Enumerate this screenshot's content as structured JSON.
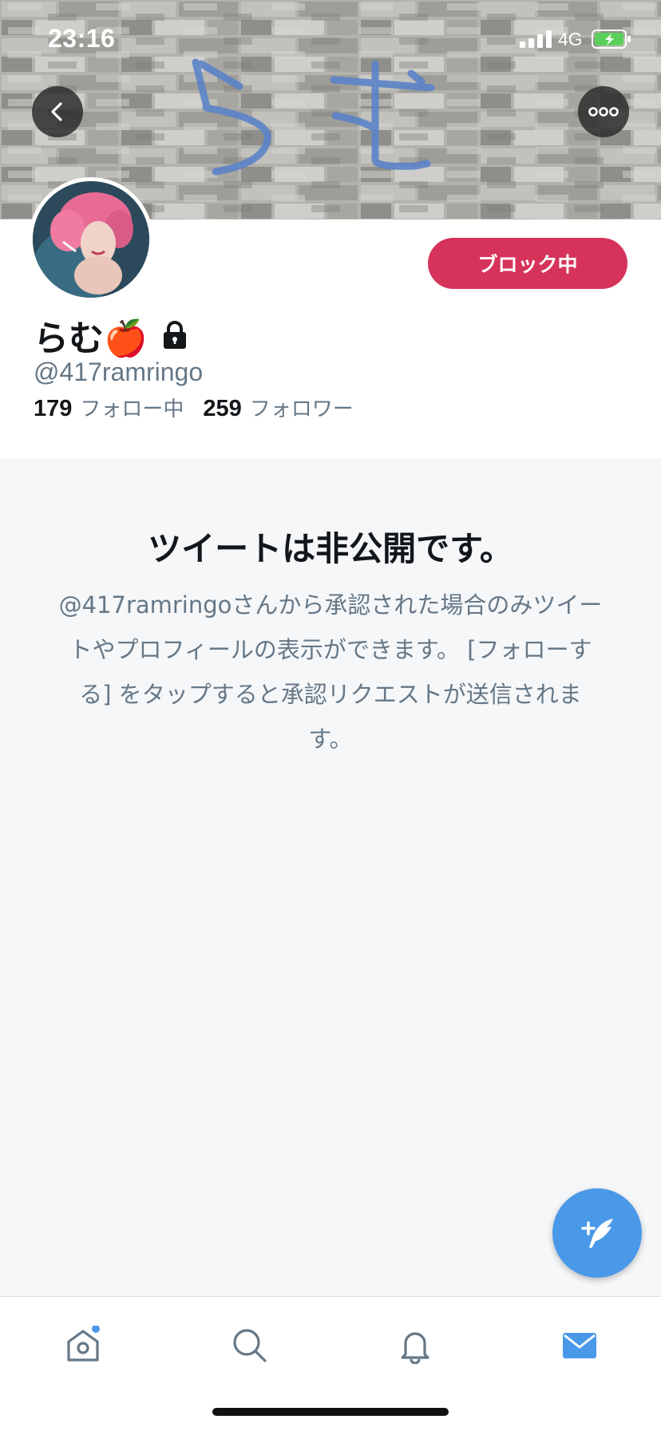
{
  "status_bar": {
    "time": "23:16",
    "network": "4G"
  },
  "banner": {
    "handwriting": "らむ"
  },
  "icons": {
    "back": "chevron-left-icon",
    "more": "more-dots-icon",
    "lock": "lock-icon",
    "compose": "compose-tweet-icon",
    "home": "home-icon",
    "search": "search-icon",
    "notifications": "bell-icon",
    "messages": "envelope-icon"
  },
  "profile": {
    "name": "らむ🍎",
    "handle": "@417ramringo",
    "following_count": "179",
    "following_label": "フォロー中",
    "followers_count": "259",
    "followers_label": "フォロワー",
    "block_button": "ブロック中"
  },
  "protected": {
    "title": "ツイートは非公開です。",
    "body": "@417ramringoさんから承認された場合のみツイートやプロフィールの表示ができます。 [フォローする] をタップすると承認リクエストが送信されます。"
  },
  "colors": {
    "accent_blue": "#4a99e9",
    "block_red": "#d6335a",
    "text_primary": "#14171a",
    "text_secondary": "#657786",
    "background_grey": "#f5f7f9"
  },
  "tabbar": {
    "active_tab": "messages"
  }
}
